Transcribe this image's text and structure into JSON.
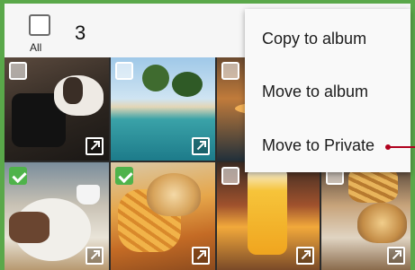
{
  "header": {
    "select_all_label": "All",
    "selected_count": "3"
  },
  "menu": {
    "items": [
      {
        "label": "Copy to album"
      },
      {
        "label": "Move to album"
      },
      {
        "label": "Move to Private"
      }
    ]
  },
  "grid": {
    "photos": [
      {
        "subject": "dog-on-bag",
        "checked": false
      },
      {
        "subject": "beach-palms",
        "checked": false
      },
      {
        "subject": "sunset",
        "checked": false
      },
      {
        "subject": "breakfast",
        "checked": true
      },
      {
        "subject": "burger-and-fries",
        "checked": true
      },
      {
        "subject": "orange-drink",
        "checked": false
      },
      {
        "subject": "burger-plate",
        "checked": false
      }
    ]
  },
  "colors": {
    "frame": "#5aa84a",
    "checkbox_checked": "#4fb34b",
    "pointer": "#b0001d"
  }
}
